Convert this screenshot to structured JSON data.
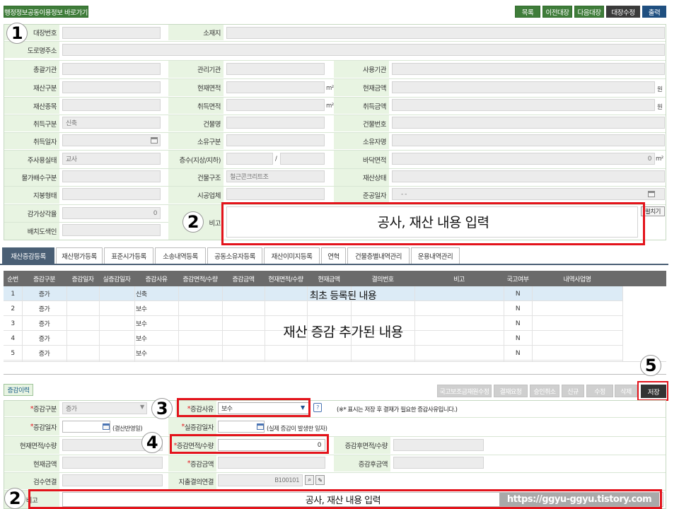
{
  "top": {
    "link_button": "행정정보공동이용정보 바로가기",
    "buttons": [
      "목록",
      "이전대장",
      "다음대장",
      "대장수정",
      "출력"
    ]
  },
  "form": {
    "asset_no": "대장번호",
    "location": "소재지",
    "road_address": "도로명주소",
    "general_agency": "총괄기관",
    "manage_agency": "관리기관",
    "use_agency": "사용기관",
    "asset_class": "재산구분",
    "current_area": "현재면적",
    "current_value": "현재금액",
    "asset_kind": "재산종목",
    "acq_area": "취득면적",
    "acq_value": "취득금액",
    "acq_type": "취득구분",
    "acq_type_value": "신축",
    "building_name": "건물명",
    "building_no": "건물번호",
    "acq_date": "취득일자",
    "owner_class": "소유구분",
    "owner_name": "소유자명",
    "main_use": "주사용실태",
    "main_use_value": "교사",
    "floors": "층수(지상/지하)",
    "floor_area": "바닥면적",
    "floor_area_value": "0",
    "price_class": "물가배수구분",
    "structure": "건물구조",
    "structure_value": "철근콘크리트조",
    "asset_status": "재산상태",
    "place": "지붕형태",
    "contractor": "시공업체",
    "complete_date": "준공일자",
    "complete_date_value": "- -",
    "depreciation": "감가상각율",
    "depreciation_value": "0",
    "note": "비고",
    "drawing_color": "배치도색인",
    "unit_m2": "m²",
    "unit_won": "원",
    "slash": "/",
    "expand_button": "펼치기"
  },
  "annotation": {
    "note_overlay": "공사, 재산 내용 입력",
    "initial_row": "최초 등록된 내용",
    "added_rows": "재산 증감 추가된 내용",
    "note_overlay2": "공사, 재산 내용 입력",
    "watermark": "https://ggyu-ggyu.tistory.com"
  },
  "markers": {
    "m1": "1",
    "m2": "2",
    "m2b": "2",
    "m3": "3",
    "m4": "4",
    "m5": "5"
  },
  "tabs": [
    "재산증감등록",
    "재산평가등록",
    "표준시가등록",
    "소송내역등록",
    "공동소유자등록",
    "재산이미지등록",
    "연혁",
    "건물층별내역관리",
    "운용내역관리"
  ],
  "table": {
    "headers": [
      "순번",
      "증감구분",
      "증감일자",
      "실증감일자",
      "증감사유",
      "증감면적/수량",
      "증감금액",
      "현재면적/수량",
      "현재금액",
      "결의번호",
      "비고",
      "국고여부",
      "내역사업명"
    ],
    "rows": [
      {
        "no": "1",
        "type": "증가",
        "reason": "신축",
        "national": "N"
      },
      {
        "no": "2",
        "type": "증가",
        "reason": "보수",
        "national": "N"
      },
      {
        "no": "3",
        "type": "증가",
        "reason": "보수",
        "national": "N"
      },
      {
        "no": "4",
        "type": "증가",
        "reason": "보수",
        "national": "N"
      },
      {
        "no": "5",
        "type": "증가",
        "reason": "보수",
        "national": "N"
      }
    ]
  },
  "actions": {
    "history_button": "증감이력",
    "buttons": [
      "국고보조금재원수정",
      "결재요청",
      "승인취소",
      "신규",
      "수정",
      "삭제",
      "저장"
    ]
  },
  "detail": {
    "change_type": "증감구분",
    "change_type_value": "증가",
    "change_reason": "증감사유",
    "change_reason_value": "보수",
    "notice": "(※* 표시는 저장 후 결재가 필요한 증감사유입니다.)",
    "change_date": "증감일자",
    "change_date_hint": "(결산반영일)",
    "real_change_date": "실증감일자",
    "real_change_date_hint": "(실제 증감이 발생한 일자)",
    "current_qty": "현재면적/수량",
    "change_qty": "증감면적/수량",
    "change_qty_value": "0",
    "after_qty": "증감후면적/수량",
    "current_amount": "현재금액",
    "change_amount": "증감금액",
    "after_amount": "증감후금액",
    "inspection": "검수연결",
    "expense_link": "지출결의연결",
    "expense_code": "B100101",
    "note": "비고"
  }
}
